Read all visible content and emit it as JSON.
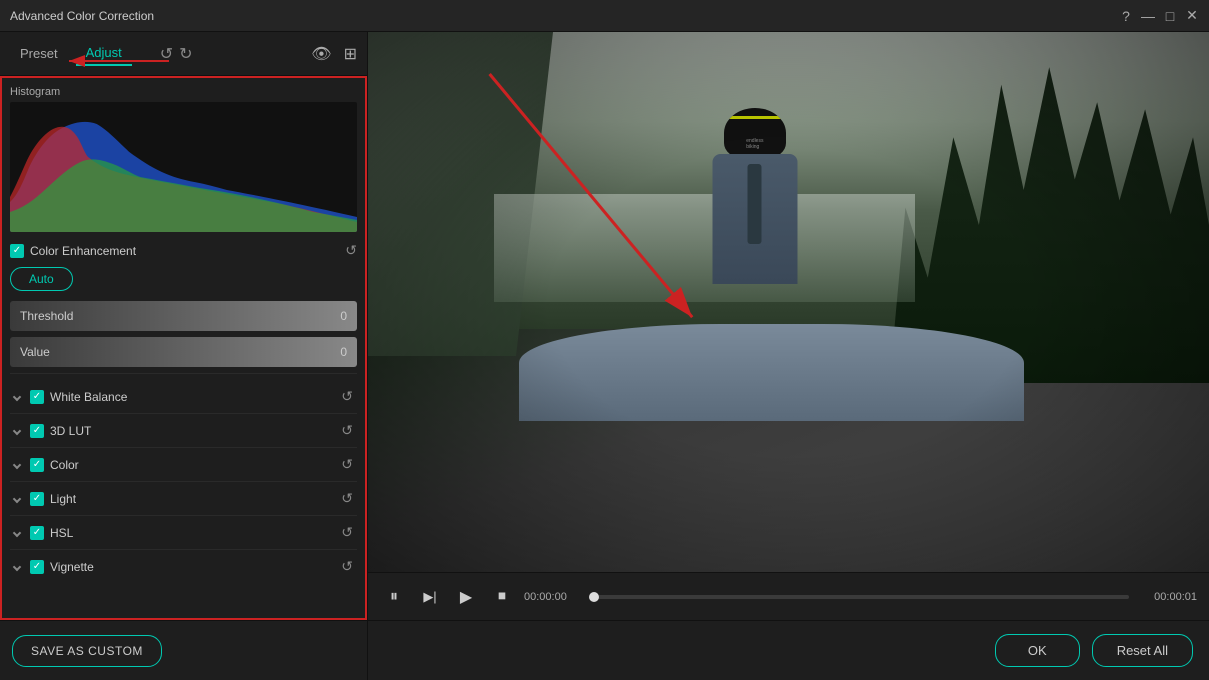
{
  "window": {
    "title": "Advanced Color Correction"
  },
  "titlebar": {
    "help_icon": "?",
    "minimize_icon": "—",
    "maximize_icon": "□",
    "close_icon": "✕"
  },
  "toolbar": {
    "preset_tab": "Preset",
    "adjust_tab": "Adjust",
    "undo_icon": "↺",
    "redo_icon": "↻"
  },
  "left_panel": {
    "histogram_label": "Histogram",
    "color_enhancement": {
      "label": "Color Enhancement",
      "checked": true
    },
    "auto_btn": "Auto",
    "threshold": {
      "label": "Threshold",
      "value": "0"
    },
    "value_slider": {
      "label": "Value",
      "value": "0"
    },
    "sections": [
      {
        "label": "White Balance",
        "checked": true
      },
      {
        "label": "3D LUT",
        "checked": true
      },
      {
        "label": "Color",
        "checked": true
      },
      {
        "label": "Light",
        "checked": true
      },
      {
        "label": "HSL",
        "checked": true
      },
      {
        "label": "Vignette",
        "checked": true
      }
    ]
  },
  "bottom": {
    "save_as_custom": "SAVE AS CUSTOM",
    "ok": "OK",
    "reset_all": "Reset All"
  },
  "video": {
    "time_current": "00:00:00",
    "time_total": "00:00:01"
  },
  "controls": {
    "pause_icon": "⏸",
    "play_icon": "▶",
    "play_forward_icon": "▶",
    "stop_icon": "⏹",
    "eye_icon": "👁",
    "image_icon": "⊞"
  }
}
